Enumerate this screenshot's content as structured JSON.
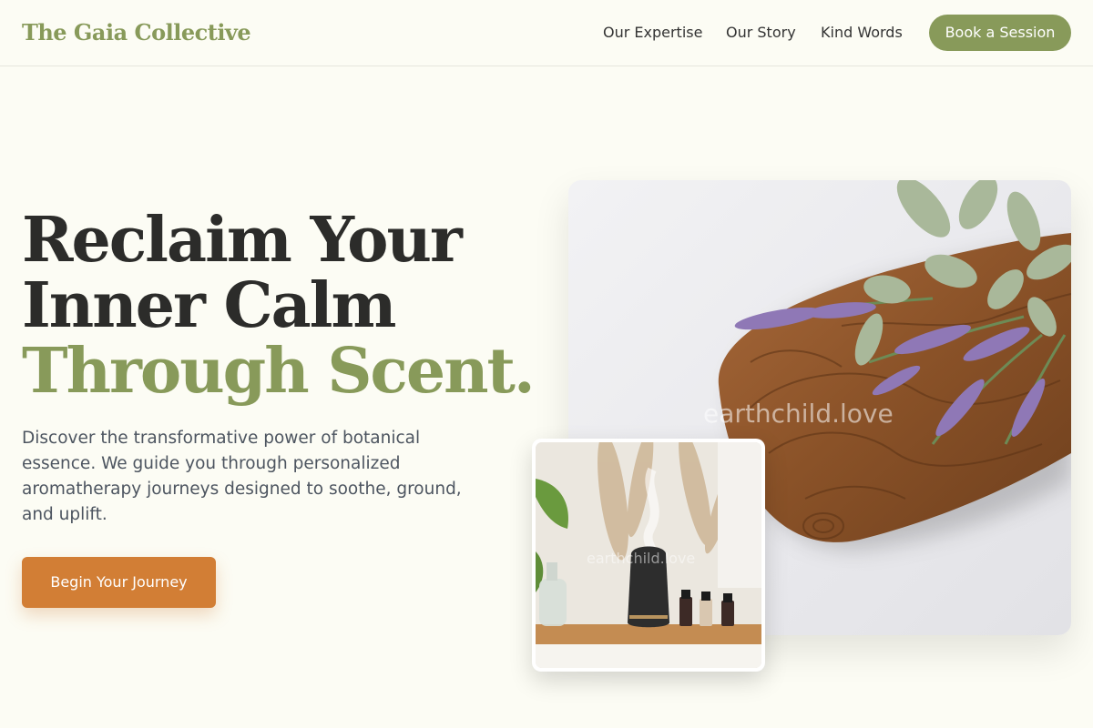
{
  "header": {
    "brand": "The Gaia Collective",
    "nav": [
      "Our Expertise",
      "Our Story",
      "Kind Words"
    ],
    "cta_label": "Book a Session"
  },
  "hero": {
    "title_lines": [
      "Reclaim Your",
      "Inner Calm"
    ],
    "title_accent": "Through Scent.",
    "description": "Discover the transformative power of botanical essence. We guide you through personalized aromatherapy journeys designed to soothe, ground, and uplift.",
    "cta_label": "Begin Your Journey"
  },
  "images": {
    "main_watermark": "earthchild.love",
    "inset_watermark": "earthchild.love"
  },
  "colors": {
    "background": "#fcfcf4",
    "sage_accent": "#889a5a",
    "orange_cta": "#d27e35",
    "heading": "#2c2c2a",
    "body_text": "#4d5560"
  }
}
